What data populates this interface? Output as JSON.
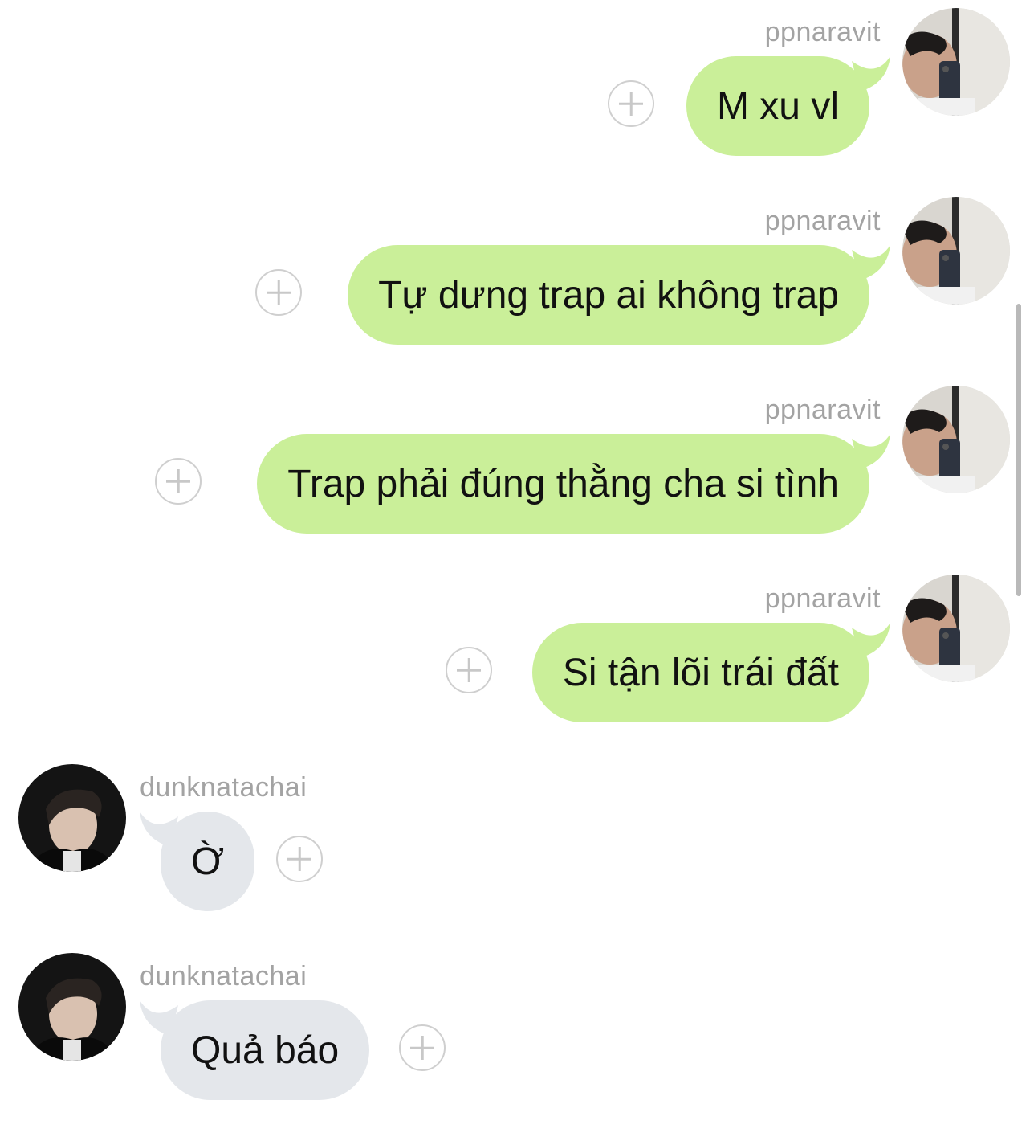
{
  "colors": {
    "outgoing_bubble": "#caef99",
    "incoming_bubble": "#e4e7eb",
    "username_text": "#a3a3a3",
    "message_text": "#111111"
  },
  "messages": [
    {
      "direction": "out",
      "username": "ppnaravit",
      "text": "M xu vl",
      "avatar": "ppnaravit-avatar",
      "action_icon": "add-reaction-icon"
    },
    {
      "direction": "out",
      "username": "ppnaravit",
      "text": "Tự dưng trap ai không trap",
      "avatar": "ppnaravit-avatar",
      "action_icon": "add-reaction-icon"
    },
    {
      "direction": "out",
      "username": "ppnaravit",
      "text": "Trap phải đúng thằng cha si tình",
      "avatar": "ppnaravit-avatar",
      "action_icon": "add-reaction-icon"
    },
    {
      "direction": "out",
      "username": "ppnaravit",
      "text": "Si tận lõi trái đất",
      "avatar": "ppnaravit-avatar",
      "action_icon": "add-reaction-icon"
    },
    {
      "direction": "in",
      "username": "dunknatachai",
      "text": "Ờ",
      "avatar": "dunknatachai-avatar",
      "action_icon": "add-reaction-icon"
    },
    {
      "direction": "in",
      "username": "dunknatachai",
      "text": "Quả báo",
      "avatar": "dunknatachai-avatar",
      "action_icon": "add-reaction-icon"
    }
  ]
}
